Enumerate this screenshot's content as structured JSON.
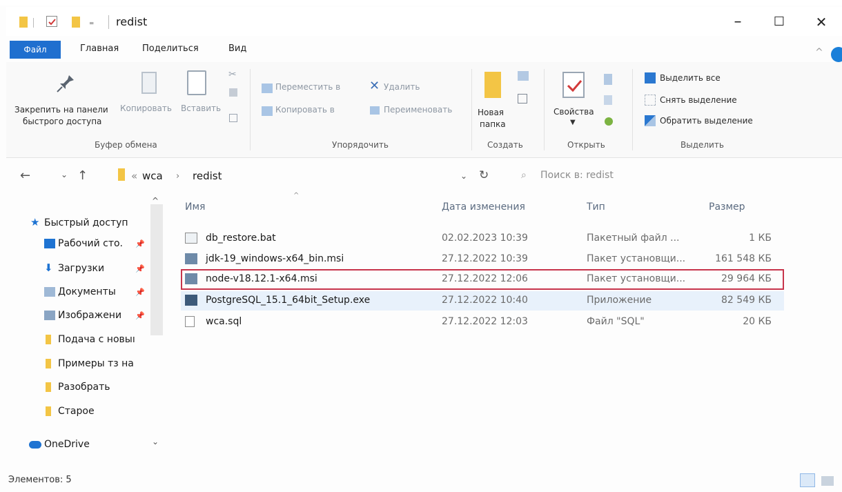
{
  "window": {
    "title": "redist",
    "minimize": "–",
    "maximize": "☐",
    "close": "✕"
  },
  "quick_access_icons": [
    "folder-icon",
    "properties-icon",
    "new-folder-icon",
    "dropdown-icon"
  ],
  "tabs": [
    {
      "label": "Файл",
      "active": true
    },
    {
      "label": "Главная"
    },
    {
      "label": "Поделиться"
    },
    {
      "label": "Вид"
    }
  ],
  "ribbon": {
    "clipboard": {
      "pin_line1": "Закрепить на панели",
      "pin_line2": "быстрого доступа",
      "copy": "Копировать",
      "paste": "Вставить",
      "group": "Буфер обмена"
    },
    "organize": {
      "move_to": "Переместить в",
      "copy_to": "Копировать в",
      "delete": "Удалить",
      "rename": "Переименовать",
      "group": "Упорядочить"
    },
    "create": {
      "new_folder_line1": "Новая",
      "new_folder_line2": "папка",
      "group": "Создать"
    },
    "open": {
      "properties": "Свойства",
      "group": "Открыть"
    },
    "select": {
      "select_all": "Выделить все",
      "select_none": "Снять выделение",
      "invert": "Обратить выделение",
      "group": "Выделить"
    }
  },
  "address": {
    "back": "←",
    "forward": "→",
    "up": "↑",
    "crumb_prefix": "«",
    "crumbs": [
      "wca",
      "redist"
    ],
    "search_placeholder": "Поиск в: redist"
  },
  "nav_pane": {
    "items": [
      {
        "label": "Быстрый доступ",
        "icon": "star-icon"
      },
      {
        "label": "Рабочий сто.",
        "icon": "desktop-icon",
        "pinned": true
      },
      {
        "label": "Загрузки",
        "icon": "download-icon",
        "pinned": true
      },
      {
        "label": "Документы",
        "icon": "documents-icon",
        "pinned": true
      },
      {
        "label": "Изображени",
        "icon": "pictures-icon",
        "pinned": true
      },
      {
        "label": "Подача с новыı",
        "icon": "folder-icon"
      },
      {
        "label": "Примеры тз на",
        "icon": "folder-icon"
      },
      {
        "label": "Разобрать",
        "icon": "folder-icon"
      },
      {
        "label": "Старое",
        "icon": "folder-icon"
      },
      {
        "label": "OneDrive",
        "icon": "cloud-icon"
      }
    ]
  },
  "columns": {
    "name": "Имя",
    "date": "Дата изменения",
    "type": "Тип",
    "size": "Размер"
  },
  "files": [
    {
      "name": "db_restore.bat",
      "date": "02.02.2023 10:39",
      "type": "Пакетный файл ...",
      "size": "1 КБ",
      "icon": "batch-file-icon"
    },
    {
      "name": "jdk-19_windows-x64_bin.msi",
      "date": "27.12.2022 10:39",
      "type": "Пакет установщи...",
      "size": "161 548 КБ",
      "icon": "msi-package-icon"
    },
    {
      "name": "node-v18.12.1-x64.msi",
      "date": "27.12.2022 12:06",
      "type": "Пакет установщи...",
      "size": "29 964 КБ",
      "icon": "msi-package-icon"
    },
    {
      "name": "PostgreSQL_15.1_64bit_Setup.exe",
      "date": "27.12.2022 10:40",
      "type": "Приложение",
      "size": "82 549 КБ",
      "icon": "exe-app-icon"
    },
    {
      "name": "wca.sql",
      "date": "27.12.2022 12:03",
      "type": "Файл \"SQL\"",
      "size": "20 КБ",
      "icon": "text-file-icon"
    }
  ],
  "status": {
    "items_count": "Элементов: 5"
  },
  "colors": {
    "accent": "#1f6fcf",
    "highlight_border": "#c7344b",
    "hover_row": "#e8f1fb"
  }
}
